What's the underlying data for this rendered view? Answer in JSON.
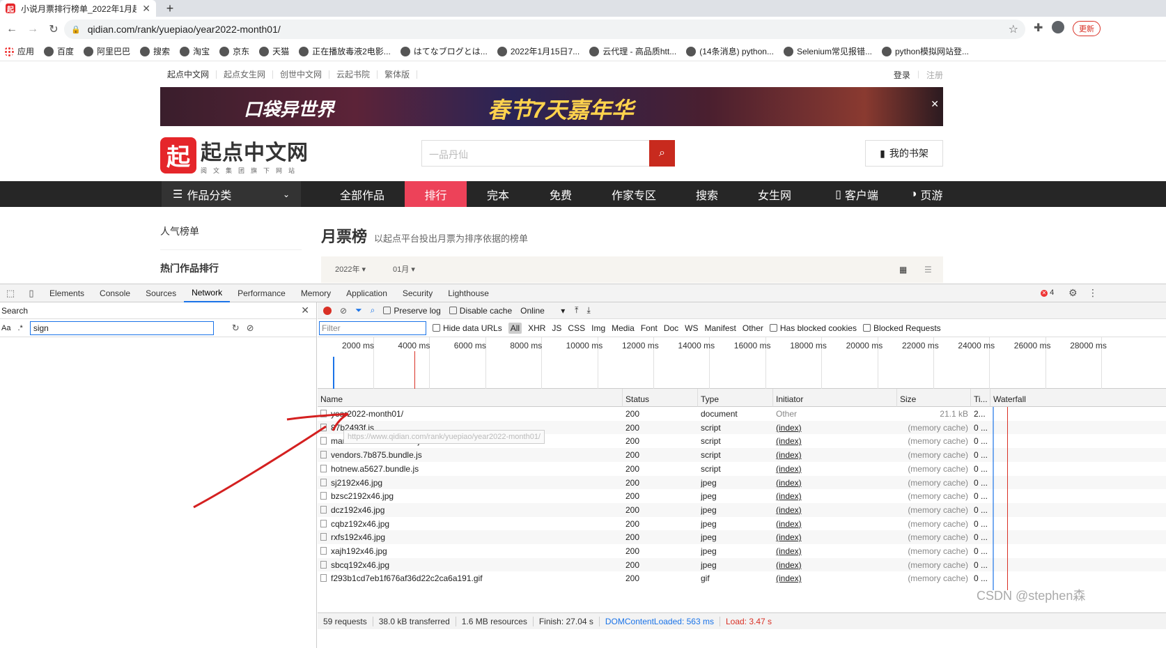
{
  "browser": {
    "tab_title": "小说月票排行榜单_2022年1月起",
    "tab_favicon": "起",
    "address": "qidian.com/rank/yuepiao/year2022-month01/",
    "update_label": "更新",
    "bookmarks": [
      "应用",
      "百度",
      "阿里巴巴",
      "搜索",
      "淘宝",
      "京东",
      "天猫",
      "正在播放毒液2电影...",
      "はてなブログとは...",
      "2022年1月15日7...",
      "云代理 - 高品质htt...",
      "(14条消息) python...",
      "Selenium常见报错...",
      "python模拟网站登..."
    ]
  },
  "site": {
    "topnav": [
      "起点中文网",
      "起点女生网",
      "创世中文网",
      "云起书院",
      "繁体版"
    ],
    "login": "登录",
    "register": "注册",
    "banner_text1": "口袋异世界",
    "banner_text2": "春节7天嘉年华",
    "logo_mark": "起",
    "logo_name": "起点中文网",
    "logo_sub": "阅文集团旗下网站",
    "search_placeholder": "一品丹仙",
    "shelf_label": "我的书架",
    "category_label": "作品分类",
    "mainnav": [
      "全部作品",
      "排行",
      "完本",
      "免费",
      "作家专区",
      "搜索",
      "女生网",
      "客户端",
      "页游"
    ],
    "mainnav_active": "排行",
    "sidebar_h1": "人气榜单",
    "sidebar_h2": "热门作品排行",
    "rank_title": "月票榜",
    "rank_desc": "以起点平台投出月票为排序依据的榜单",
    "year_select": "2022年",
    "month_select": "01月"
  },
  "devtools": {
    "tabs": [
      "Elements",
      "Console",
      "Sources",
      "Network",
      "Performance",
      "Memory",
      "Application",
      "Security",
      "Lighthouse"
    ],
    "active_tab": "Network",
    "error_count": "4",
    "search_title": "Search",
    "search_aa": "Aa",
    "search_regex": ".*",
    "search_value": "sign",
    "preserve_log": "Preserve log",
    "disable_cache": "Disable cache",
    "throttle": "Online",
    "filter_placeholder": "Filter",
    "hide_data_urls": "Hide data URLs",
    "types": [
      "All",
      "XHR",
      "JS",
      "CSS",
      "Img",
      "Media",
      "Font",
      "Doc",
      "WS",
      "Manifest",
      "Other"
    ],
    "has_blocked": "Has blocked cookies",
    "blocked_requests": "Blocked Requests",
    "timeline_ticks": [
      "2000 ms",
      "4000 ms",
      "6000 ms",
      "8000 ms",
      "10000 ms",
      "12000 ms",
      "14000 ms",
      "16000 ms",
      "18000 ms",
      "20000 ms",
      "22000 ms",
      "24000 ms",
      "26000 ms",
      "28000 ms"
    ],
    "columns": [
      "Name",
      "Status",
      "Type",
      "Initiator",
      "Size",
      "Ti...",
      "Waterfall"
    ],
    "rows": [
      {
        "name": "year2022-month01/",
        "status": "200",
        "type": "document",
        "initiator": "Other",
        "size": "21.1 kB",
        "time": "2..."
      },
      {
        "name": "87b2493f.js",
        "status": "200",
        "type": "script",
        "initiator": "(index)",
        "size": "(memory cache)",
        "time": "0 ..."
      },
      {
        "name": "manifest.877db.bundle.js",
        "status": "200",
        "type": "script",
        "initiator": "(index)",
        "size": "(memory cache)",
        "time": "0 ..."
      },
      {
        "name": "vendors.7b875.bundle.js",
        "status": "200",
        "type": "script",
        "initiator": "(index)",
        "size": "(memory cache)",
        "time": "0 ..."
      },
      {
        "name": "hotnew.a5627.bundle.js",
        "status": "200",
        "type": "script",
        "initiator": "(index)",
        "size": "(memory cache)",
        "time": "0 ..."
      },
      {
        "name": "sj2192x46.jpg",
        "status": "200",
        "type": "jpeg",
        "initiator": "(index)",
        "size": "(memory cache)",
        "time": "0 ..."
      },
      {
        "name": "bzsc2192x46.jpg",
        "status": "200",
        "type": "jpeg",
        "initiator": "(index)",
        "size": "(memory cache)",
        "time": "0 ..."
      },
      {
        "name": "dcz192x46.jpg",
        "status": "200",
        "type": "jpeg",
        "initiator": "(index)",
        "size": "(memory cache)",
        "time": "0 ..."
      },
      {
        "name": "cqbz192x46.jpg",
        "status": "200",
        "type": "jpeg",
        "initiator": "(index)",
        "size": "(memory cache)",
        "time": "0 ..."
      },
      {
        "name": "rxfs192x46.jpg",
        "status": "200",
        "type": "jpeg",
        "initiator": "(index)",
        "size": "(memory cache)",
        "time": "0 ..."
      },
      {
        "name": "xajh192x46.jpg",
        "status": "200",
        "type": "jpeg",
        "initiator": "(index)",
        "size": "(memory cache)",
        "time": "0 ..."
      },
      {
        "name": "sbcq192x46.jpg",
        "status": "200",
        "type": "jpeg",
        "initiator": "(index)",
        "size": "(memory cache)",
        "time": "0 ..."
      },
      {
        "name": "f293b1cd7eb1f676af36d22c2ca6a191.gif",
        "status": "200",
        "type": "gif",
        "initiator": "(index)",
        "size": "(memory cache)",
        "time": "0 ..."
      }
    ],
    "tooltip": "https://www.qidian.com/rank/yuepiao/year2022-month01/",
    "status": {
      "requests": "59 requests",
      "transferred": "38.0 kB transferred",
      "resources": "1.6 MB resources",
      "finish": "Finish: 27.04 s",
      "dcl": "DOMContentLoaded: 563 ms",
      "load": "Load: 3.47 s"
    }
  },
  "watermark": "CSDN @stephen森",
  "colors": {
    "brand": "#e5262a",
    "nav_active": "#ed4259",
    "devtools_blue": "#1a73e8",
    "dcl": "#1a73e8",
    "load": "#d93025"
  }
}
